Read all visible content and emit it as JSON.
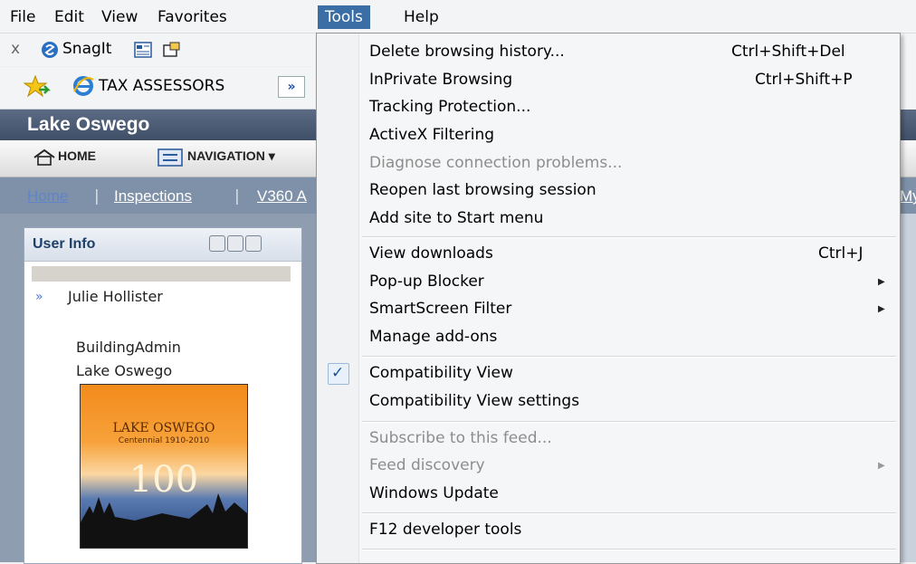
{
  "menubar": {
    "items": [
      "File",
      "Edit",
      "View",
      "Favorites",
      "Tools",
      "Help"
    ]
  },
  "commandbar": {
    "close_label": "x",
    "snagit_label": "SnagIt"
  },
  "favorites_bar": {
    "site_label": "TAX ASSESSORS",
    "more_label": "»"
  },
  "page": {
    "site_title": "Lake Oswego",
    "nav": {
      "home_label": "HOME",
      "navigation_label": "NAVIGATION ▾"
    },
    "breadcrumb": [
      "Home",
      "Inspections",
      "V360 A"
    ],
    "breadcrumb_tail": "My",
    "panel": {
      "title": "User Info",
      "user_name": "Julie Hollister",
      "role": "BuildingAdmin",
      "org": "Lake Oswego",
      "logo": {
        "title": "LAKE OSWEGO",
        "subtitle": "Centennial 1910-2010",
        "number": "100"
      }
    }
  },
  "tools_menu": {
    "items": [
      {
        "label": "Delete browsing history...",
        "shortcut": "Ctrl+Shift+Del",
        "enabled": true
      },
      {
        "label": "InPrivate Browsing",
        "shortcut": "Ctrl+Shift+P",
        "enabled": true
      },
      {
        "label": "Tracking Protection...",
        "enabled": true
      },
      {
        "label": "ActiveX Filtering",
        "enabled": true
      },
      {
        "label": "Diagnose connection problems...",
        "enabled": false
      },
      {
        "label": "Reopen last browsing session",
        "enabled": true
      },
      {
        "label": "Add site to Start menu",
        "enabled": true
      },
      {
        "label": "View downloads",
        "shortcut": "Ctrl+J",
        "enabled": true
      },
      {
        "label": "Pop-up Blocker",
        "submenu": true,
        "enabled": true
      },
      {
        "label": "SmartScreen Filter",
        "submenu": true,
        "enabled": true
      },
      {
        "label": "Manage add-ons",
        "enabled": true
      },
      {
        "label": "Compatibility View",
        "checked": true,
        "enabled": true
      },
      {
        "label": "Compatibility View settings",
        "enabled": true
      },
      {
        "label": "Subscribe to this feed...",
        "enabled": false
      },
      {
        "label": "Feed discovery",
        "submenu": true,
        "enabled": false
      },
      {
        "label": "Windows Update",
        "enabled": true
      },
      {
        "label": "F12 developer tools",
        "enabled": true
      }
    ]
  },
  "colors": {
    "menu_highlight": "#3a6ea5",
    "page_bg": "#8e9db0",
    "header_bg": "#4b5b73",
    "link": "#ffffff"
  }
}
